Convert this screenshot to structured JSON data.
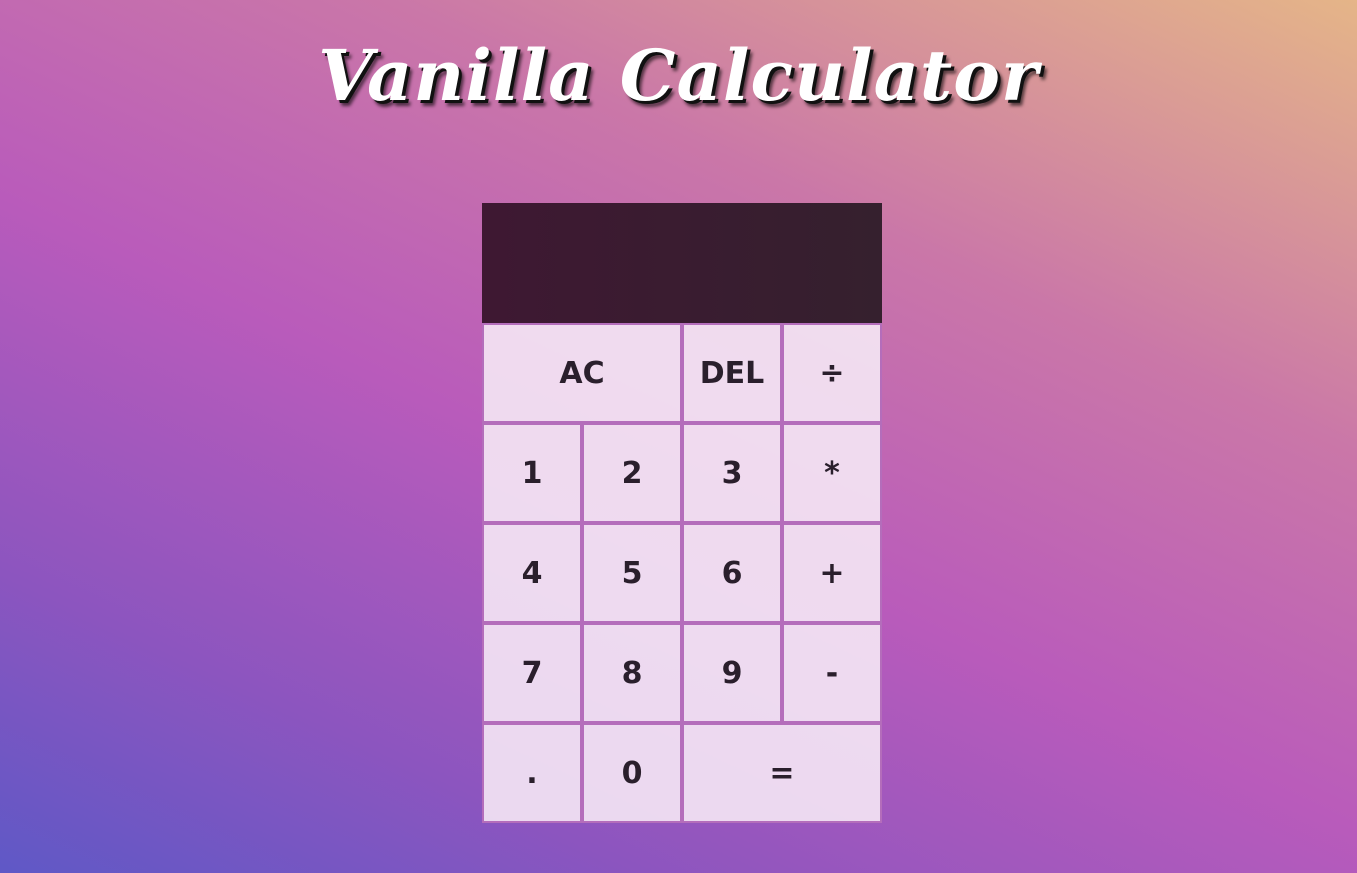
{
  "app": {
    "title": "Vanilla Calculator"
  },
  "display": {
    "previous_operand": "",
    "current_operand": ""
  },
  "keys": {
    "clear": "AC",
    "delete": "DEL",
    "divide": "÷",
    "one": "1",
    "two": "2",
    "three": "3",
    "multiply": "*",
    "four": "4",
    "five": "5",
    "six": "6",
    "add": "+",
    "seven": "7",
    "eight": "8",
    "nine": "9",
    "subtract": "-",
    "decimal": ".",
    "zero": "0",
    "equals": "="
  },
  "colors": {
    "display_background": "#3a1b30",
    "key_background": "#f2e4f1",
    "key_border": "#b46dbb",
    "key_text": "#2a1f2c",
    "title_text": "#ffffff"
  }
}
